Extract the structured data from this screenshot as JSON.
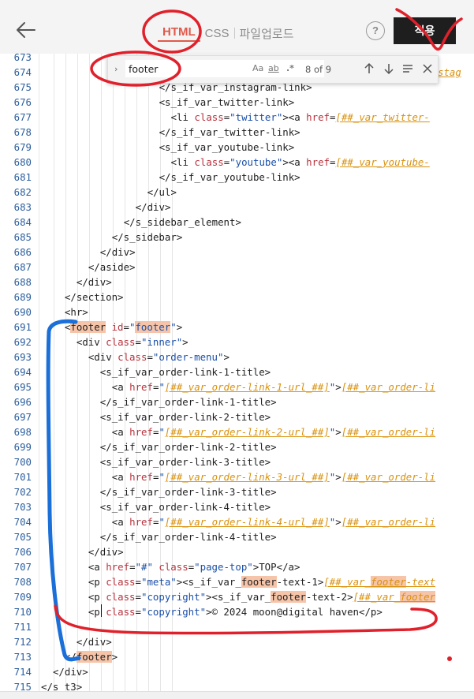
{
  "toolbar": {
    "tabs": [
      {
        "label": "HTML",
        "active": true
      },
      {
        "label": "CSS",
        "active": false
      },
      {
        "label": "파일업로드",
        "active": false
      }
    ],
    "help_label": "?",
    "apply_label": "적용"
  },
  "find": {
    "query": "footer",
    "count": "8 of 9",
    "options": [
      "Aa",
      "ab",
      ".*"
    ]
  },
  "colors": {
    "active_tab": "#e0594b",
    "apply_button_bg": "#1e1e1e",
    "tag": "#1f1f1f",
    "attribute": "#b8323c",
    "string": "#1a4fa8",
    "variable": "#d9920e",
    "match_highlight": "#f6c4a8",
    "line_number": "#2c5fa0",
    "annotation_red": "#e0202a",
    "annotation_blue": "#1a6fd8"
  },
  "icons": [
    "back-arrow-icon",
    "help-icon",
    "expand-chevron-icon",
    "arrow-up-icon",
    "arrow-down-icon",
    "find-in-selection-icon",
    "close-icon"
  ],
  "editor": {
    "lines": [
      {
        "n": "673",
        "code": ""
      },
      {
        "n": "674",
        "code": ""
      },
      {
        "n": "675",
        "code": "</s_if_var_instagram-link>"
      },
      {
        "n": "676",
        "code": "<s_if_var_twitter-link>"
      },
      {
        "n": "677",
        "code": "<li class=\"twitter\"><a href=\"[##_var_twitter-"
      },
      {
        "n": "678",
        "code": "</s_if_var_twitter-link>"
      },
      {
        "n": "679",
        "code": "<s_if_var_youtube-link>"
      },
      {
        "n": "680",
        "code": "<li class=\"youtube\"><a href=\"[##_var_youtube-"
      },
      {
        "n": "681",
        "code": "</s_if_var_youtube-link>"
      },
      {
        "n": "682",
        "code": "</ul>"
      },
      {
        "n": "683",
        "code": "</div>"
      },
      {
        "n": "684",
        "code": "</s_sidebar_element>"
      },
      {
        "n": "685",
        "code": "</s_sidebar>"
      },
      {
        "n": "686",
        "code": "</div>"
      },
      {
        "n": "687",
        "code": "</aside>"
      },
      {
        "n": "688",
        "code": "</div>"
      },
      {
        "n": "689",
        "code": "</section>"
      },
      {
        "n": "690",
        "code": "<hr>"
      },
      {
        "n": "691",
        "code": "<footer id=\"footer\">"
      },
      {
        "n": "692",
        "code": "<div class=\"inner\">"
      },
      {
        "n": "693",
        "code": "<div class=\"order-menu\">"
      },
      {
        "n": "694",
        "code": "<s_if_var_order-link-1-title>"
      },
      {
        "n": "695",
        "code": "<a href=\"[##_var_order-link-1-url_##]\">[##_var_order-li"
      },
      {
        "n": "696",
        "code": "</s_if_var_order-link-1-title>"
      },
      {
        "n": "697",
        "code": "<s_if_var_order-link-2-title>"
      },
      {
        "n": "698",
        "code": "<a href=\"[##_var_order-link-2-url_##]\">[##_var_order-li"
      },
      {
        "n": "699",
        "code": "</s_if_var_order-link-2-title>"
      },
      {
        "n": "700",
        "code": "<s_if_var_order-link-3-title>"
      },
      {
        "n": "701",
        "code": "<a href=\"[##_var_order-link-3-url_##]\">[##_var_order-li"
      },
      {
        "n": "702",
        "code": "</s_if_var_order-link-3-title>"
      },
      {
        "n": "703",
        "code": "<s_if_var_order-link-4-title>"
      },
      {
        "n": "704",
        "code": "<a href=\"[##_var_order-link-4-url_##]\">[##_var_order-li"
      },
      {
        "n": "705",
        "code": "</s_if_var_order-link-4-title>"
      },
      {
        "n": "706",
        "code": "</div>"
      },
      {
        "n": "707",
        "code": "<a href=\"#\" class=\"page-top\">TOP</a>"
      },
      {
        "n": "708",
        "code": "<p class=\"meta\"><s_if_var_footer-text-1>[##_var_footer-text"
      },
      {
        "n": "709",
        "code": "<p class=\"copyright\"><s_if_var_footer-text-2>[##_var_footer"
      },
      {
        "n": "710",
        "code": "<p class=\"copyright\">© 2024 moon@digital haven</p>"
      },
      {
        "n": "711",
        "code": ""
      },
      {
        "n": "712",
        "code": "</div>"
      },
      {
        "n": "713",
        "code": "</footer>"
      },
      {
        "n": "714",
        "code": "</div>"
      },
      {
        "n": "715",
        "code": "</s_t3>"
      }
    ],
    "line_674_tail": "stag"
  }
}
